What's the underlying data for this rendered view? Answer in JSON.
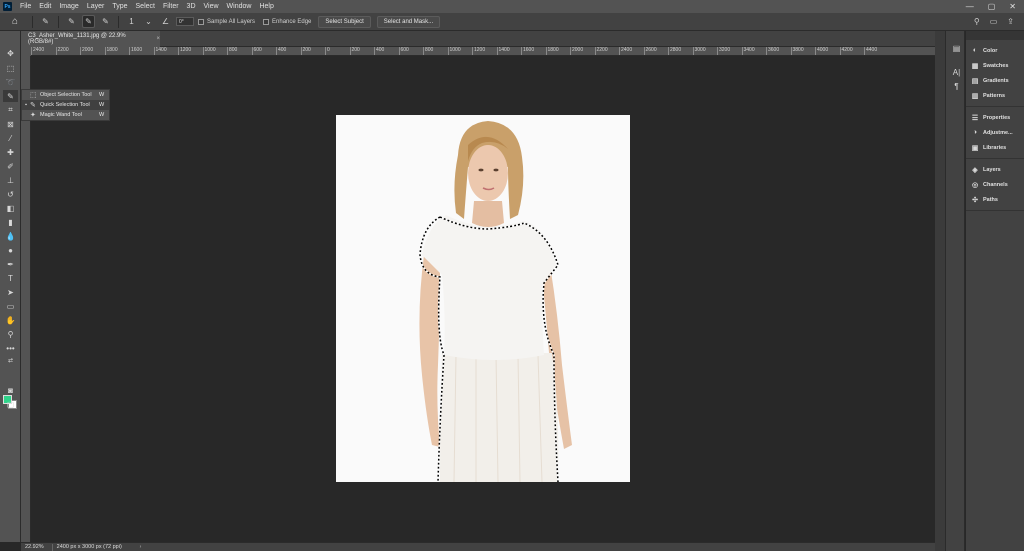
{
  "app": {
    "logo": "Ps",
    "window_controls": [
      "—",
      "▢",
      "✕"
    ]
  },
  "menu": [
    "File",
    "Edit",
    "Image",
    "Layer",
    "Type",
    "Select",
    "Filter",
    "3D",
    "View",
    "Window",
    "Help"
  ],
  "options_bar": {
    "brush_size": "1",
    "angle_value": "0°",
    "sample_all_layers": "Sample All Layers",
    "enhance_edge": "Enhance Edge",
    "select_subject": "Select Subject",
    "select_and_mask": "Select and Mask..."
  },
  "document_tab": {
    "title": "C3_Asher_White_1131.jpg @ 22.9% (RGB/8#)",
    "close": "×"
  },
  "ruler_labels": [
    "2400",
    "2200",
    "2000",
    "1800",
    "1600",
    "1400",
    "1200",
    "1000",
    "800",
    "600",
    "400",
    "200",
    "0",
    "200",
    "400",
    "600",
    "800",
    "1000",
    "1200",
    "1400",
    "1600",
    "1800",
    "2000",
    "2200",
    "2400",
    "2600",
    "2800",
    "3000",
    "3200",
    "3400",
    "3600",
    "3800",
    "4000",
    "4200",
    "4400"
  ],
  "tool_flyout": [
    {
      "icon": "object-selection-icon",
      "glyph": "⬚",
      "label": "Object Selection Tool",
      "key": "W",
      "selected": false
    },
    {
      "icon": "quick-selection-icon",
      "glyph": "✎",
      "label": "Quick Selection Tool",
      "key": "W",
      "selected": true
    },
    {
      "icon": "magic-wand-icon",
      "glyph": "✦",
      "label": "Magic Wand Tool",
      "key": "W",
      "selected": false
    }
  ],
  "status": {
    "zoom": "22.92%",
    "doc_info": "2400 px x 3000 px (72 ppi)",
    "arrow": "›"
  },
  "panels": {
    "group1": [
      {
        "icon": "color-icon",
        "glyph": "◐",
        "label": "Color"
      },
      {
        "icon": "swatches-icon",
        "glyph": "▦",
        "label": "Swatches"
      },
      {
        "icon": "gradients-icon",
        "glyph": "▤",
        "label": "Gradients"
      },
      {
        "icon": "patterns-icon",
        "glyph": "▥",
        "label": "Patterns"
      }
    ],
    "group2": [
      {
        "icon": "properties-icon",
        "glyph": "☰",
        "label": "Properties"
      },
      {
        "icon": "adjustments-icon",
        "glyph": "◑",
        "label": "Adjustme..."
      },
      {
        "icon": "libraries-icon",
        "glyph": "▣",
        "label": "Libraries"
      }
    ],
    "group3": [
      {
        "icon": "layers-icon",
        "glyph": "◈",
        "label": "Layers"
      },
      {
        "icon": "channels-icon",
        "glyph": "◎",
        "label": "Channels"
      },
      {
        "icon": "paths-icon",
        "glyph": "✣",
        "label": "Paths"
      }
    ]
  },
  "colors": {
    "foreground": "#2fd38a",
    "background": "#ffffff",
    "workspace": "#282828",
    "panel": "#424242"
  }
}
